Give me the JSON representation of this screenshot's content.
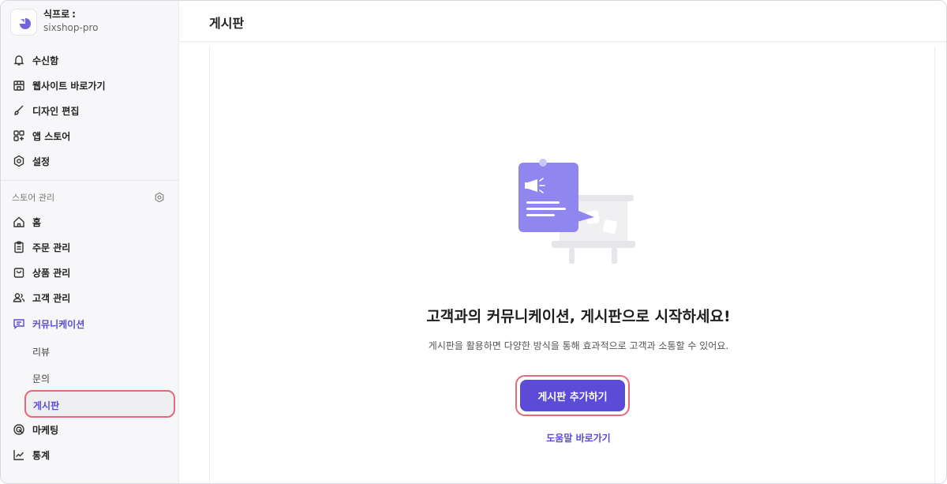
{
  "store": {
    "name": "식프로",
    "id": "sixshop-pro"
  },
  "sidebar": {
    "top_items": [
      {
        "label": "수신함",
        "icon": "bell-icon"
      },
      {
        "label": "웹사이트 바로가기",
        "icon": "storefront-icon"
      },
      {
        "label": "디자인 편집",
        "icon": "brush-icon"
      },
      {
        "label": "앱 스토어",
        "icon": "apps-plus-icon"
      },
      {
        "label": "설정",
        "icon": "gear-icon"
      }
    ],
    "section_title": "스토어 관리",
    "manage_items": [
      {
        "label": "홈",
        "icon": "home-icon"
      },
      {
        "label": "주문 관리",
        "icon": "clipboard-icon"
      },
      {
        "label": "상품 관리",
        "icon": "shopping-bag-icon"
      },
      {
        "label": "고객 관리",
        "icon": "users-icon"
      },
      {
        "label": "커뮤니케이션",
        "icon": "chat-icon"
      }
    ],
    "sub_items": [
      {
        "label": "리뷰"
      },
      {
        "label": "문의"
      },
      {
        "label": "게시판"
      }
    ],
    "bottom_items": [
      {
        "label": "마케팅",
        "icon": "target-icon"
      },
      {
        "label": "통계",
        "icon": "line-chart-icon"
      }
    ]
  },
  "header": {
    "title": "게시판"
  },
  "empty_state": {
    "headline": "고객과의 커뮤니케이션, 게시판으로 시작하세요!",
    "description": "게시판을 활용하면 다양한 방식을 통해 효과적으로 고객과 소통할 수 있어요.",
    "cta_label": "게시판 추가하기",
    "help_link": "도움말 바로가기"
  },
  "colors": {
    "accent": "#5b4bd6",
    "highlight": "#e36b79",
    "illustration": "#8f86f0"
  }
}
